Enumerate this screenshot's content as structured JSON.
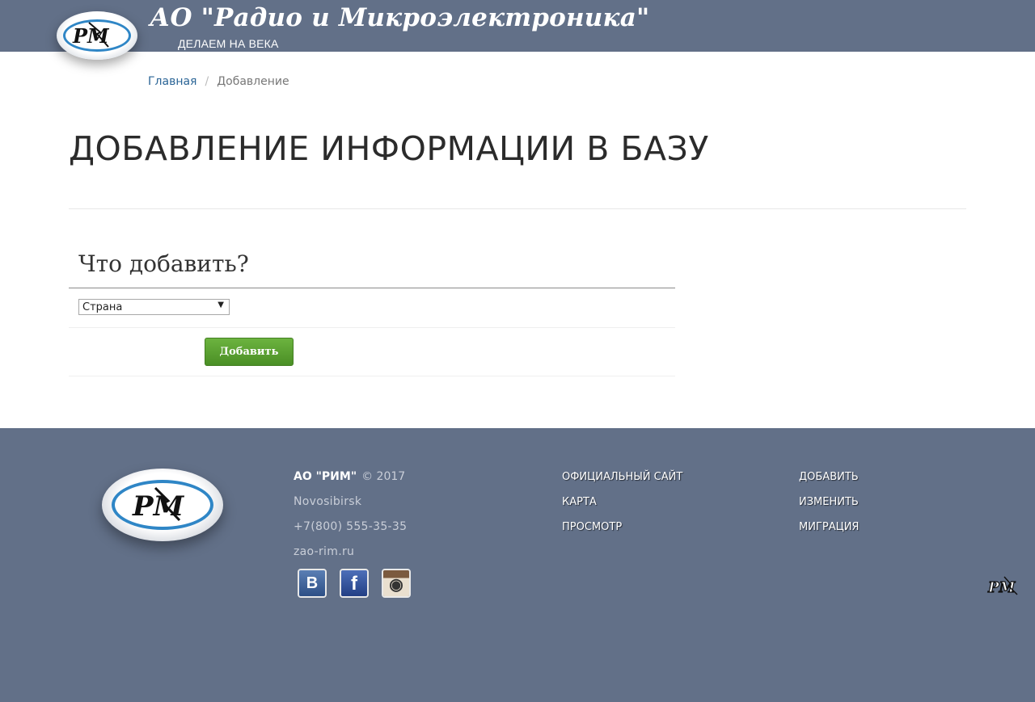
{
  "header": {
    "title": "АО \"Радио и Микроэлектроника\"",
    "slogan": "ДЕЛАЕМ НА ВЕКА",
    "logo_icon": "rim-logo-icon",
    "logo_text": "РМ"
  },
  "breadcrumb": {
    "home": "Главная",
    "current": "Добавление"
  },
  "page": {
    "title": "ДОБАВЛЕНИЕ ИНФОРМАЦИИ В БАЗУ"
  },
  "form": {
    "heading": "Что добавить?",
    "select_value": "Страна",
    "submit_label": "Добавить"
  },
  "footer": {
    "company": "АО \"РИМ\"",
    "copyright": "© 2017",
    "city": "Novosibirsk",
    "phone": "+7(800) 555-35-35",
    "website": "zao-rim.ru",
    "links_col1": [
      "ОФИЦИАЛЬНЫЙ САЙТ",
      "КАРТА",
      "ПРОСМОТР"
    ],
    "links_col2": [
      "ДОБАВИТЬ",
      "ИЗМЕНИТЬ",
      "МИГРАЦИЯ"
    ],
    "social": [
      {
        "icon": "vk-icon",
        "glyph": "B",
        "color": "#3d5f94"
      },
      {
        "icon": "facebook-icon",
        "glyph": "f",
        "color": "#2f4d93"
      },
      {
        "icon": "instagram-icon",
        "glyph": "◉",
        "color": "#a87b56"
      }
    ]
  },
  "colors": {
    "header_bg": "#627088",
    "link": "#2a6496",
    "button_green": "#5aa232",
    "logo_blue": "#2f86c6"
  }
}
